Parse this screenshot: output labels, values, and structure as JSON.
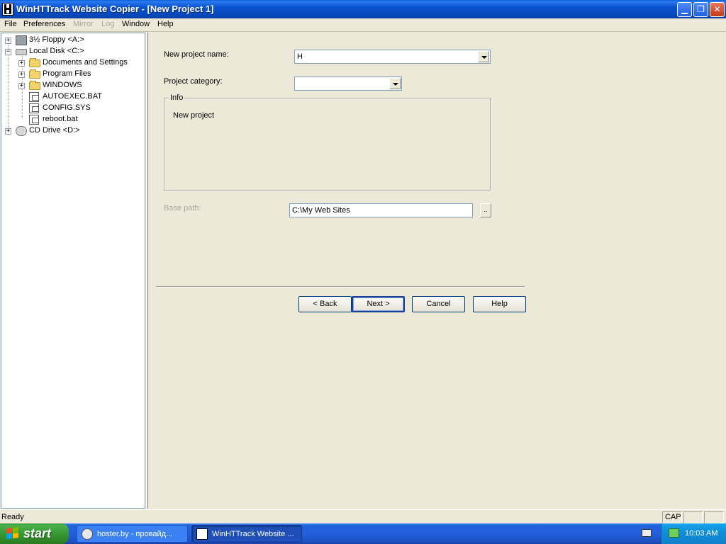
{
  "window": {
    "title": "WinHTTrack Website Copier - [New Project 1]",
    "icon": "httrack-app-icon",
    "controls": [
      "minimize-icon",
      "restore-icon",
      "close-icon"
    ]
  },
  "menu": {
    "items": [
      {
        "label": "File",
        "enabled": true
      },
      {
        "label": "Preferences",
        "enabled": true
      },
      {
        "label": "Mirror",
        "enabled": false
      },
      {
        "label": "Log",
        "enabled": false
      },
      {
        "label": "Window",
        "enabled": true
      },
      {
        "label": "Help",
        "enabled": true
      }
    ]
  },
  "tree": {
    "nodes": [
      {
        "label": "3½ Floppy <A:>",
        "icon": "floppy-drive-icon",
        "expander": "+"
      },
      {
        "label": "Local Disk <C:>",
        "icon": "hard-drive-icon",
        "expander": "−"
      },
      {
        "label": "Documents and Settings",
        "icon": "folder-icon",
        "expander": "+"
      },
      {
        "label": "Program Files",
        "icon": "folder-icon",
        "expander": "+"
      },
      {
        "label": "WINDOWS",
        "icon": "folder-icon",
        "expander": "+"
      },
      {
        "label": "AUTOEXEC.BAT",
        "icon": "batch-file-icon"
      },
      {
        "label": "CONFIG.SYS",
        "icon": "system-file-icon"
      },
      {
        "label": "reboot.bat",
        "icon": "batch-file-icon"
      },
      {
        "label": "CD Drive <D:>",
        "icon": "cd-drive-icon",
        "expander": "+"
      }
    ]
  },
  "form": {
    "project_name_label": "New project name:",
    "project_name_value": "H",
    "project_category_label": "Project category:",
    "project_category_value": "",
    "info_legend": "Info",
    "info_text": "New project",
    "base_path_label": "Base path:",
    "base_path_value": "C:\\My Web Sites",
    "browse_label": ".."
  },
  "buttons": {
    "back": "< Back",
    "next": "Next >",
    "cancel": "Cancel",
    "help": "Help"
  },
  "statusbar": {
    "text": "Ready",
    "cap": "CAP"
  },
  "taskbar": {
    "start_label": "start",
    "items": [
      {
        "label": "hoster.by - провайд...",
        "icon": "browser-icon"
      },
      {
        "label": "WinHTTrack Website ...",
        "icon": "httrack-app-icon",
        "active": true
      }
    ],
    "clock": "10:03 AM"
  },
  "colors": {
    "titlebar": "#0a52d0",
    "taskbar": "#245edb",
    "start_button": "#36952e",
    "tray": "#0f8bd8",
    "window_bg": "#ece9d8",
    "disabled_text": "#a8a59a"
  }
}
